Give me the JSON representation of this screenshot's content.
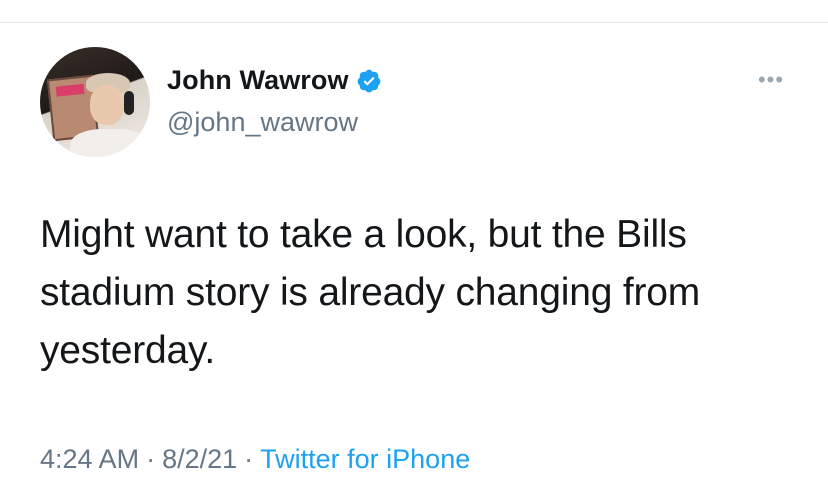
{
  "tweet": {
    "author": {
      "display_name": "John Wawrow",
      "handle": "@john_wawrow",
      "verified": true
    },
    "more_label": "•••",
    "text": "Might want to take a look, but the Bills stadium story is already changing from yesterday.",
    "time": "4:24 AM",
    "date": "8/2/21",
    "separator": "·",
    "source": "Twitter for iPhone"
  },
  "colors": {
    "primary_text": "#14171a",
    "secondary_text": "#657786",
    "accent": "#1da1f2",
    "divider": "#e1e8ed"
  },
  "icons": {
    "verified": "verified-badge-icon",
    "more": "more-dots-icon"
  }
}
